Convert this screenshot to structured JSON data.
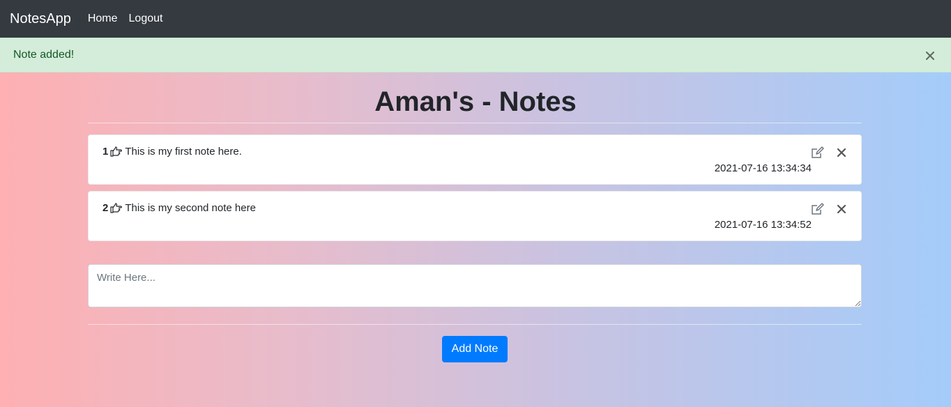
{
  "navbar": {
    "brand": "NotesApp",
    "links": [
      "Home",
      "Logout"
    ]
  },
  "alert": {
    "message": "Note added!",
    "close_glyph": "close-icon"
  },
  "page": {
    "title": "Aman's - Notes"
  },
  "notes": [
    {
      "number": "1",
      "text": "This is my first note here.",
      "timestamp": "2021-07-16 13:34:34",
      "icon": "hand-point-right-icon"
    },
    {
      "number": "2",
      "text": "This is my second note here",
      "timestamp": "2021-07-16 13:34:52",
      "icon": "hand-point-right-icon"
    }
  ],
  "form": {
    "placeholder": "Write Here...",
    "value": "",
    "submit_label": "Add Note"
  },
  "colors": {
    "navbar_bg": "#343a40",
    "alert_bg": "#d4edda",
    "alert_text": "#155724",
    "button_bg": "#007bff",
    "gradient_start": "#feb0b2",
    "gradient_end": "#a4ccfa"
  }
}
